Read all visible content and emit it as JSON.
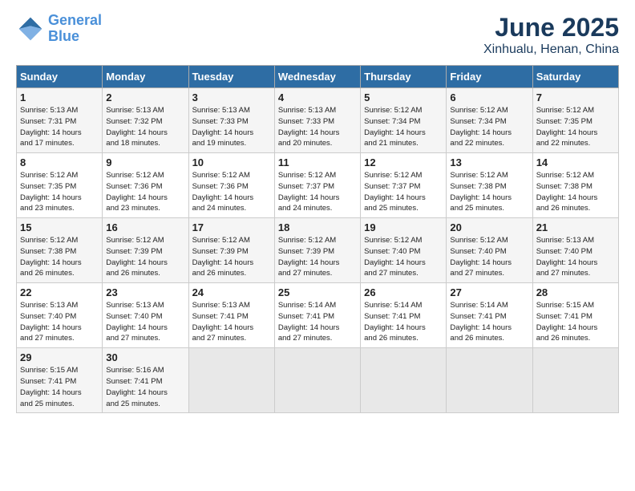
{
  "header": {
    "logo_line1": "General",
    "logo_line2": "Blue",
    "title": "June 2025",
    "subtitle": "Xinhualu, Henan, China"
  },
  "weekdays": [
    "Sunday",
    "Monday",
    "Tuesday",
    "Wednesday",
    "Thursday",
    "Friday",
    "Saturday"
  ],
  "weeks": [
    [
      {
        "day": "1",
        "rise": "5:13 AM",
        "set": "7:31 PM",
        "hours": "14",
        "mins": "17"
      },
      {
        "day": "2",
        "rise": "5:13 AM",
        "set": "7:32 PM",
        "hours": "14",
        "mins": "18"
      },
      {
        "day": "3",
        "rise": "5:13 AM",
        "set": "7:33 PM",
        "hours": "14",
        "mins": "19"
      },
      {
        "day": "4",
        "rise": "5:13 AM",
        "set": "7:33 PM",
        "hours": "14",
        "mins": "20"
      },
      {
        "day": "5",
        "rise": "5:12 AM",
        "set": "7:34 PM",
        "hours": "14",
        "mins": "21"
      },
      {
        "day": "6",
        "rise": "5:12 AM",
        "set": "7:34 PM",
        "hours": "14",
        "mins": "22"
      },
      {
        "day": "7",
        "rise": "5:12 AM",
        "set": "7:35 PM",
        "hours": "14",
        "mins": "22"
      }
    ],
    [
      {
        "day": "8",
        "rise": "5:12 AM",
        "set": "7:35 PM",
        "hours": "14",
        "mins": "23"
      },
      {
        "day": "9",
        "rise": "5:12 AM",
        "set": "7:36 PM",
        "hours": "14",
        "mins": "23"
      },
      {
        "day": "10",
        "rise": "5:12 AM",
        "set": "7:36 PM",
        "hours": "14",
        "mins": "24"
      },
      {
        "day": "11",
        "rise": "5:12 AM",
        "set": "7:37 PM",
        "hours": "14",
        "mins": "24"
      },
      {
        "day": "12",
        "rise": "5:12 AM",
        "set": "7:37 PM",
        "hours": "14",
        "mins": "25"
      },
      {
        "day": "13",
        "rise": "5:12 AM",
        "set": "7:38 PM",
        "hours": "14",
        "mins": "25"
      },
      {
        "day": "14",
        "rise": "5:12 AM",
        "set": "7:38 PM",
        "hours": "14",
        "mins": "26"
      }
    ],
    [
      {
        "day": "15",
        "rise": "5:12 AM",
        "set": "7:38 PM",
        "hours": "14",
        "mins": "26"
      },
      {
        "day": "16",
        "rise": "5:12 AM",
        "set": "7:39 PM",
        "hours": "14",
        "mins": "26"
      },
      {
        "day": "17",
        "rise": "5:12 AM",
        "set": "7:39 PM",
        "hours": "14",
        "mins": "26"
      },
      {
        "day": "18",
        "rise": "5:12 AM",
        "set": "7:39 PM",
        "hours": "14",
        "mins": "27"
      },
      {
        "day": "19",
        "rise": "5:12 AM",
        "set": "7:40 PM",
        "hours": "14",
        "mins": "27"
      },
      {
        "day": "20",
        "rise": "5:12 AM",
        "set": "7:40 PM",
        "hours": "14",
        "mins": "27"
      },
      {
        "day": "21",
        "rise": "5:13 AM",
        "set": "7:40 PM",
        "hours": "14",
        "mins": "27"
      }
    ],
    [
      {
        "day": "22",
        "rise": "5:13 AM",
        "set": "7:40 PM",
        "hours": "14",
        "mins": "27"
      },
      {
        "day": "23",
        "rise": "5:13 AM",
        "set": "7:40 PM",
        "hours": "14",
        "mins": "27"
      },
      {
        "day": "24",
        "rise": "5:13 AM",
        "set": "7:41 PM",
        "hours": "14",
        "mins": "27"
      },
      {
        "day": "25",
        "rise": "5:14 AM",
        "set": "7:41 PM",
        "hours": "14",
        "mins": "27"
      },
      {
        "day": "26",
        "rise": "5:14 AM",
        "set": "7:41 PM",
        "hours": "14",
        "mins": "26"
      },
      {
        "day": "27",
        "rise": "5:14 AM",
        "set": "7:41 PM",
        "hours": "14",
        "mins": "26"
      },
      {
        "day": "28",
        "rise": "5:15 AM",
        "set": "7:41 PM",
        "hours": "14",
        "mins": "26"
      }
    ],
    [
      {
        "day": "29",
        "rise": "5:15 AM",
        "set": "7:41 PM",
        "hours": "14",
        "mins": "25"
      },
      {
        "day": "30",
        "rise": "5:16 AM",
        "set": "7:41 PM",
        "hours": "14",
        "mins": "25"
      },
      null,
      null,
      null,
      null,
      null
    ]
  ]
}
